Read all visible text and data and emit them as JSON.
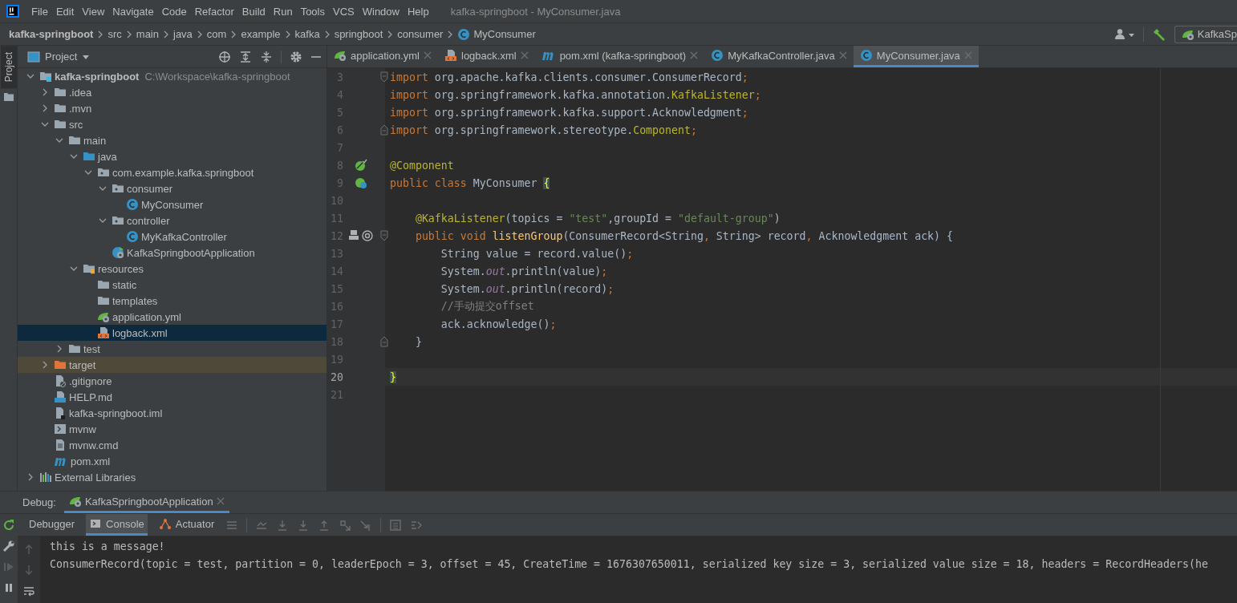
{
  "menu": {
    "items": [
      "File",
      "Edit",
      "View",
      "Navigate",
      "Code",
      "Refactor",
      "Build",
      "Run",
      "Tools",
      "VCS",
      "Window",
      "Help"
    ],
    "title": "kafka-springboot - MyConsumer.java"
  },
  "breadcrumb": [
    {
      "label": "kafka-springboot",
      "kind": "project"
    },
    {
      "label": "src",
      "kind": "dir"
    },
    {
      "label": "main",
      "kind": "dir"
    },
    {
      "label": "java",
      "kind": "dir"
    },
    {
      "label": "com",
      "kind": "dir"
    },
    {
      "label": "example",
      "kind": "dir"
    },
    {
      "label": "kafka",
      "kind": "dir"
    },
    {
      "label": "springboot",
      "kind": "dir"
    },
    {
      "label": "consumer",
      "kind": "dir"
    },
    {
      "label": "MyConsumer",
      "kind": "class"
    }
  ],
  "run_config": {
    "label": "KafkaSp"
  },
  "side_stripe": {
    "label": "Project"
  },
  "project": {
    "title": "Project",
    "tree": [
      {
        "label": "kafka-springboot",
        "hint": "C:\\Workspace\\kafka-springboot",
        "kind": "module",
        "expanded": true,
        "selected": false,
        "children": [
          {
            "label": ".idea",
            "kind": "folder",
            "expanded": false,
            "selected": false
          },
          {
            "label": ".mvn",
            "kind": "folder",
            "expanded": false,
            "selected": false
          },
          {
            "label": "src",
            "kind": "folder",
            "expanded": true,
            "selected": false,
            "children": [
              {
                "label": "main",
                "kind": "folder",
                "expanded": true,
                "selected": false,
                "children": [
                  {
                    "label": "java",
                    "kind": "source",
                    "expanded": true,
                    "selected": false,
                    "children": [
                      {
                        "label": "com.example.kafka.springboot",
                        "kind": "package",
                        "expanded": true,
                        "selected": false,
                        "children": [
                          {
                            "label": "consumer",
                            "kind": "package",
                            "expanded": true,
                            "selected": false,
                            "children": [
                              {
                                "label": "MyConsumer",
                                "kind": "class",
                                "selected": false
                              }
                            ]
                          },
                          {
                            "label": "controller",
                            "kind": "package",
                            "expanded": true,
                            "selected": false,
                            "children": [
                              {
                                "label": "MyKafkaController",
                                "kind": "class",
                                "selected": false
                              }
                            ]
                          },
                          {
                            "label": "KafkaSpringbootApplication",
                            "kind": "spring",
                            "selected": false
                          }
                        ]
                      }
                    ]
                  },
                  {
                    "label": "resources",
                    "kind": "resources",
                    "expanded": true,
                    "selected": false,
                    "children": [
                      {
                        "label": "static",
                        "kind": "folder",
                        "selected": false
                      },
                      {
                        "label": "templates",
                        "kind": "folder",
                        "selected": false
                      },
                      {
                        "label": "application.yml",
                        "kind": "yml",
                        "selected": false
                      },
                      {
                        "label": "logback.xml",
                        "kind": "xml",
                        "selected": true
                      }
                    ]
                  }
                ]
              },
              {
                "label": "test",
                "kind": "folder",
                "expanded": false,
                "selected": false
              }
            ]
          },
          {
            "label": "target",
            "kind": "excluded",
            "expanded": false,
            "selected": false
          },
          {
            "label": ".gitignore",
            "kind": "ignore",
            "selected": false
          },
          {
            "label": "HELP.md",
            "kind": "md",
            "selected": false
          },
          {
            "label": "kafka-springboot.iml",
            "kind": "iml",
            "selected": false
          },
          {
            "label": "mvnw",
            "kind": "script",
            "selected": false
          },
          {
            "label": "mvnw.cmd",
            "kind": "text",
            "selected": false
          },
          {
            "label": "pom.xml",
            "kind": "maven",
            "selected": false
          }
        ]
      },
      {
        "label": "External Libraries",
        "kind": "libraries",
        "expanded": false,
        "selected": false
      }
    ]
  },
  "tabs": [
    {
      "label": "application.yml",
      "kind": "yml",
      "selected": false
    },
    {
      "label": "logback.xml",
      "kind": "xml",
      "selected": false
    },
    {
      "label": "pom.xml (kafka-springboot)",
      "kind": "maven",
      "selected": false
    },
    {
      "label": "MyKafkaController.java",
      "kind": "class",
      "selected": false
    },
    {
      "label": "MyConsumer.java",
      "kind": "class",
      "selected": true
    }
  ],
  "code": [
    {
      "number": "3",
      "current": false,
      "fold": {
        "kind": "start"
      },
      "tokens": [
        {
          "text": "import",
          "kind": "keyword"
        },
        {
          "text": " org.apache.kafka.clients.consumer.ConsumerRecord",
          "kind": "plain"
        },
        {
          "text": ";",
          "kind": "keyword"
        }
      ]
    },
    {
      "number": "4",
      "current": false,
      "tokens": [
        {
          "text": "import",
          "kind": "keyword"
        },
        {
          "text": " org.springframework.kafka.annotation.",
          "kind": "plain"
        },
        {
          "text": "KafkaListener",
          "kind": "annotation"
        },
        {
          "text": ";",
          "kind": "keyword"
        }
      ]
    },
    {
      "number": "5",
      "current": false,
      "tokens": [
        {
          "text": "import",
          "kind": "keyword"
        },
        {
          "text": " org.springframework.kafka.support.Acknowledgment",
          "kind": "plain"
        },
        {
          "text": ";",
          "kind": "keyword"
        }
      ]
    },
    {
      "number": "6",
      "current": false,
      "fold": {
        "kind": "end"
      },
      "tokens": [
        {
          "text": "import",
          "kind": "keyword"
        },
        {
          "text": " org.springframework.stereotype.",
          "kind": "plain"
        },
        {
          "text": "Component",
          "kind": "annotation"
        },
        {
          "text": ";",
          "kind": "keyword"
        }
      ]
    },
    {
      "number": "7",
      "current": false
    },
    {
      "number": "8",
      "current": false,
      "marker": {
        "kind": "bean"
      },
      "tokens": [
        {
          "text": "@Component",
          "kind": "annotation"
        }
      ]
    },
    {
      "number": "9",
      "current": false,
      "marker": {
        "kind": "bean-class"
      },
      "tokens": [
        {
          "text": "public class ",
          "kind": "keyword"
        },
        {
          "text": "MyConsumer ",
          "kind": "plain"
        },
        {
          "text": "{",
          "kind": "brace"
        }
      ]
    },
    {
      "number": "10",
      "current": false
    },
    {
      "number": "11",
      "current": false,
      "tokens": [
        {
          "text": "    @KafkaListener",
          "kind": "annotation"
        },
        {
          "text": "(topics = ",
          "kind": "plain"
        },
        {
          "text": "\"test\"",
          "kind": "string"
        },
        {
          "text": ",groupId = ",
          "kind": "plain"
        },
        {
          "text": "\"default-group\"",
          "kind": "string"
        },
        {
          "text": ")",
          "kind": "plain"
        }
      ]
    },
    {
      "number": "12",
      "current": false,
      "marker": {
        "kind": "listener"
      },
      "fold": {
        "kind": "start"
      },
      "tokens": [
        {
          "text": "    public void ",
          "kind": "keyword"
        },
        {
          "text": "listenGroup",
          "kind": "method"
        },
        {
          "text": "(ConsumerRecord<String",
          "kind": "plain"
        },
        {
          "text": ",",
          "kind": "keyword"
        },
        {
          "text": " String> record",
          "kind": "plain"
        },
        {
          "text": ",",
          "kind": "keyword"
        },
        {
          "text": " Acknowledgment ack) {",
          "kind": "plain"
        }
      ]
    },
    {
      "number": "13",
      "current": false,
      "tokens": [
        {
          "text": "        String value = record.value()",
          "kind": "plain"
        },
        {
          "text": ";",
          "kind": "keyword"
        }
      ]
    },
    {
      "number": "14",
      "current": false,
      "tokens": [
        {
          "text": "        System.",
          "kind": "plain"
        },
        {
          "text": "out",
          "kind": "static"
        },
        {
          "text": ".println(value)",
          "kind": "plain"
        },
        {
          "text": ";",
          "kind": "keyword"
        }
      ]
    },
    {
      "number": "15",
      "current": false,
      "tokens": [
        {
          "text": "        System.",
          "kind": "plain"
        },
        {
          "text": "out",
          "kind": "static"
        },
        {
          "text": ".println(record)",
          "kind": "plain"
        },
        {
          "text": ";",
          "kind": "keyword"
        }
      ]
    },
    {
      "number": "16",
      "current": false,
      "tokens": [
        {
          "text": "        //手动提交offset",
          "kind": "comment"
        }
      ]
    },
    {
      "number": "17",
      "current": false,
      "tokens": [
        {
          "text": "        ack.acknowledge()",
          "kind": "plain"
        },
        {
          "text": ";",
          "kind": "keyword"
        }
      ]
    },
    {
      "number": "18",
      "current": false,
      "fold": {
        "kind": "end"
      },
      "tokens": [
        {
          "text": "    }",
          "kind": "plain"
        }
      ]
    },
    {
      "number": "19",
      "current": false
    },
    {
      "number": "20",
      "current": true,
      "tokens": [
        {
          "text": "}",
          "kind": "brace"
        }
      ]
    },
    {
      "number": "21",
      "current": false
    }
  ],
  "debug": {
    "label": "Debug:",
    "session": "KafkaSpringbootApplication",
    "tabs": [
      {
        "label": "Debugger",
        "kind": "plain",
        "selected": false
      },
      {
        "label": "Console",
        "kind": "console",
        "selected": true
      },
      {
        "label": "Actuator",
        "kind": "actuator",
        "selected": false
      }
    ],
    "console": [
      "this is a message!",
      "ConsumerRecord(topic = test, partition = 0, leaderEpoch = 3, offset = 45, CreateTime = 1676307650011, serialized key size = 3, serialized value size = 18, headers = RecordHeaders(he"
    ]
  }
}
